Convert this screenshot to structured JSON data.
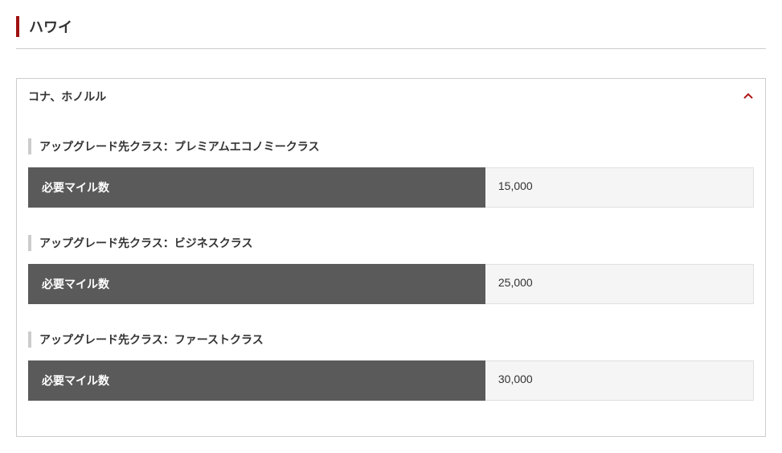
{
  "section_title": "ハワイ",
  "accordion": {
    "header": "コナ、ホノルル",
    "expanded": true,
    "items": [
      {
        "class_label": "アップグレード先クラス：プレミアムエコノミークラス",
        "miles_label": "必要マイル数",
        "miles_value": "15,000"
      },
      {
        "class_label": "アップグレード先クラス：ビジネスクラス",
        "miles_label": "必要マイル数",
        "miles_value": "25,000"
      },
      {
        "class_label": "アップグレード先クラス：ファーストクラス",
        "miles_label": "必要マイル数",
        "miles_value": "30,000"
      }
    ]
  }
}
